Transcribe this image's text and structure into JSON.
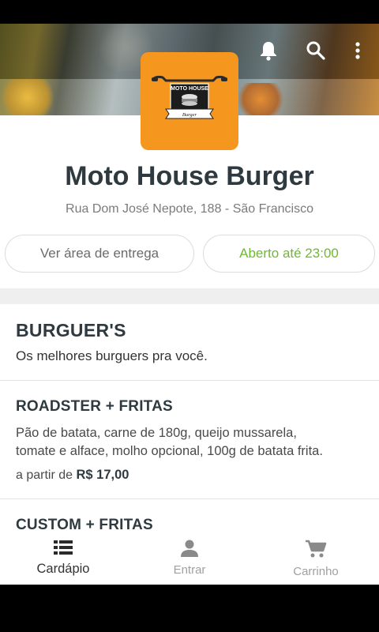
{
  "toolbar": {
    "icons": [
      "bell-icon",
      "search-icon",
      "more-vert-icon"
    ]
  },
  "store": {
    "logo_top_text": "MOTO HOUSE",
    "logo_bottom_text": "Burger",
    "name": "Moto House Burger",
    "address": "Rua Dom José Nepote, 188 - São Francisco",
    "delivery_area_label": "Ver área de entrega",
    "hours_label": "Aberto até 23:00"
  },
  "section": {
    "title": "BURGUER'S",
    "description": "Os melhores burguers pra você."
  },
  "items": [
    {
      "name": "ROADSTER + FRITAS",
      "description_line1": "Pão de batata, carne de 180g, queijo mussarela,",
      "description_line2": "tomate e alface, molho opcional, 100g de batata frita.",
      "price_prefix": "a partir de",
      "price": "R$ 17,00"
    },
    {
      "name": "CUSTOM + FRITAS"
    }
  ],
  "bottom_nav": [
    {
      "label": "Cardápio",
      "icon": "menu-list-icon",
      "active": true
    },
    {
      "label": "Entrar",
      "icon": "person-icon",
      "active": false
    },
    {
      "label": "Carrinho",
      "icon": "cart-icon",
      "active": false
    }
  ],
  "colors": {
    "brand_orange": "#f5961e",
    "open_green": "#6cbb2d",
    "title_dark": "#2f3a40"
  }
}
